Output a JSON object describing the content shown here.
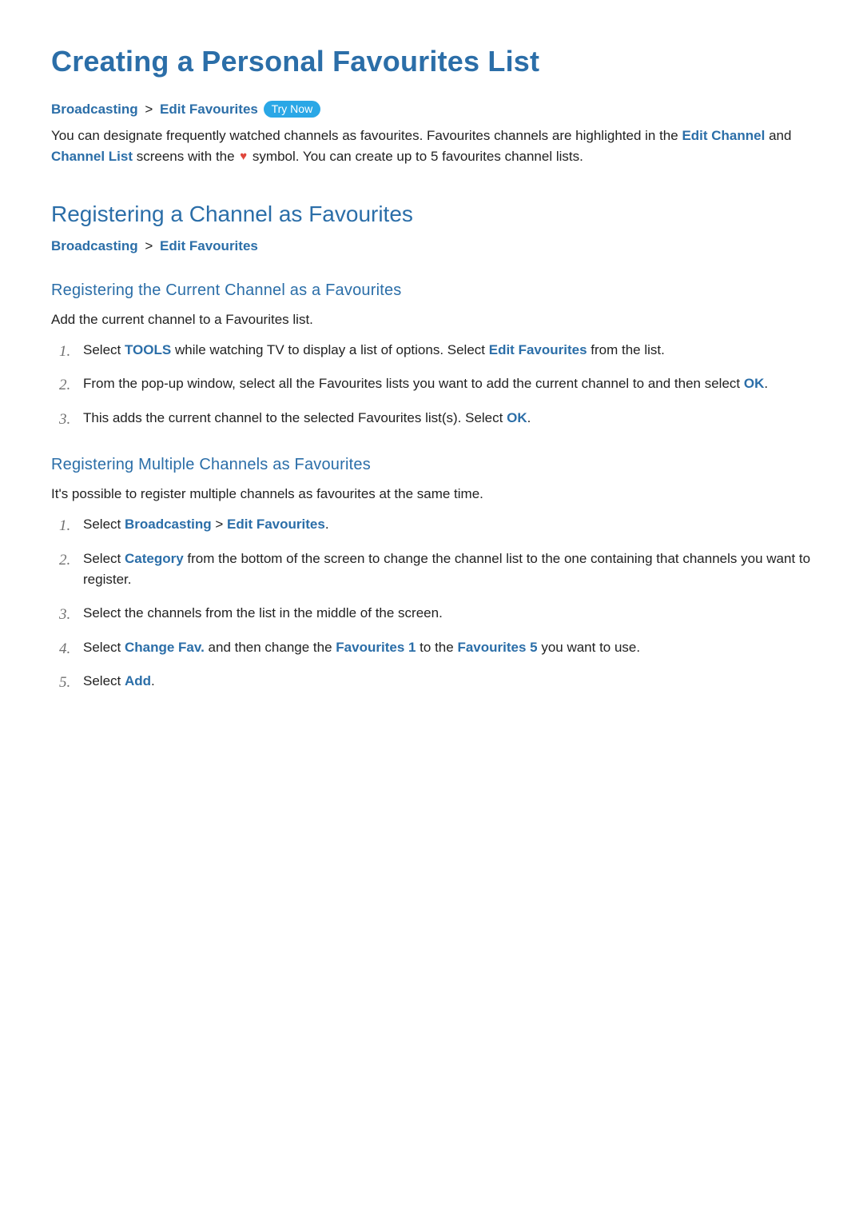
{
  "page": {
    "title": "Creating a Personal Favourites List"
  },
  "breadcrumb1": {
    "a": "Broadcasting",
    "sep": ">",
    "b": "Edit Favourites",
    "trynow": "Try Now"
  },
  "intro": {
    "t1": "You can designate frequently watched channels as favourites. Favourites channels are highlighted in the ",
    "term1": "Edit Channel",
    "t2": " and ",
    "term2": "Channel List",
    "t3": " screens with the ",
    "t4": " symbol. You can create up to 5 favourites channel lists."
  },
  "section1": {
    "heading": "Registering a Channel as Favourites",
    "bc_a": "Broadcasting",
    "bc_sep": ">",
    "bc_b": "Edit Favourites"
  },
  "sub1": {
    "heading": "Registering the Current Channel as a Favourites",
    "lead": "Add the current channel to a Favourites list.",
    "step1_a": "Select ",
    "step1_tools": "TOOLS",
    "step1_b": " while watching TV to display a list of options. Select ",
    "step1_ef": "Edit Favourites",
    "step1_c": " from the list.",
    "step2_a": "From the pop-up window, select all the Favourites lists you want to add the current channel to and then select ",
    "step2_ok": "OK",
    "step2_b": ".",
    "step3_a": "This adds the current channel to the selected Favourites list(s). Select ",
    "step3_ok": "OK",
    "step3_b": "."
  },
  "sub2": {
    "heading": "Registering Multiple Channels as Favourites",
    "lead": "It's possible to register multiple channels as favourites at the same time.",
    "step1_a": "Select ",
    "step1_bcast": "Broadcasting",
    "step1_sep": " > ",
    "step1_ef": "Edit Favourites",
    "step1_b": ".",
    "step2_a": "Select ",
    "step2_cat": "Category",
    "step2_b": " from the bottom of the screen to change the channel list to the one containing that channels you want to register.",
    "step3": "Select the channels from the list in the middle of the screen.",
    "step4_a": "Select ",
    "step4_cf": "Change Fav.",
    "step4_b": " and then change the ",
    "step4_f1": "Favourites 1",
    "step4_c": " to the ",
    "step4_f5": "Favourites 5",
    "step4_d": " you want to use.",
    "step5_a": "Select ",
    "step5_add": "Add",
    "step5_b": "."
  }
}
